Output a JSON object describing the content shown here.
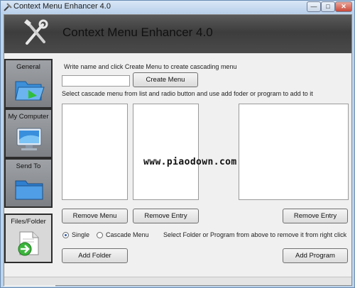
{
  "window": {
    "title": "Context Menu Enhancer 4.0",
    "min_glyph": "—",
    "max_glyph": "□",
    "close_glyph": "✕"
  },
  "header": {
    "title": "Context Menu Enhancer 4.0",
    "icon": "tools-icon"
  },
  "sidebar": {
    "items": [
      {
        "label": "General",
        "icon": "folder-icon"
      },
      {
        "label": "My Computer",
        "icon": "monitor-icon"
      },
      {
        "label": "Send To",
        "icon": "blue-folder-icon"
      },
      {
        "label": "Files/Folder",
        "icon": "file-arrow-icon"
      }
    ]
  },
  "main": {
    "instruction_name": "Write name and click Create Menu to create cascading menu",
    "name_value": "",
    "create_menu_label": "Create Menu",
    "instruction_select": "Select cascade menu from list and radio button and use add foder or program to add to it",
    "remove_menu_label": "Remove Menu",
    "remove_entry_label": "Remove Entry",
    "remove_entry_right_label": "Remove Entry",
    "radio_single_label": "Single",
    "radio_cascade_label": "Cascade Menu",
    "radio_selected": "Single",
    "select_remove_hint": "Select Folder or Program from above to remove it from right click",
    "add_folder_label": "Add Folder",
    "add_program_label": "Add Program"
  },
  "watermark": "www.piaodown.com",
  "colors": {
    "header_bg": "#4a4a4a",
    "sidebar_btn": "#8e9195",
    "window_frame": "#bcd3ea"
  }
}
